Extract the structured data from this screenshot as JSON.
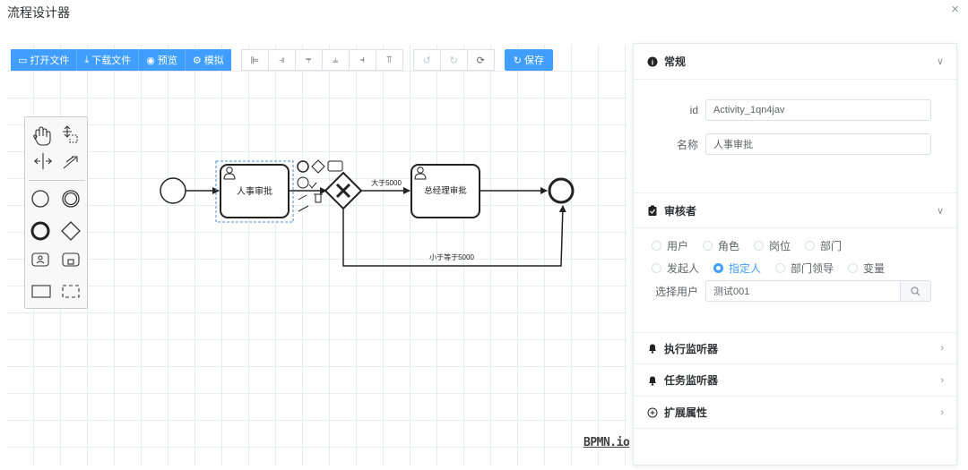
{
  "dialog": {
    "title": "流程设计器",
    "close": "×"
  },
  "toolbar": {
    "open_file": "打开文件",
    "download_file": "下载文件",
    "preview": "预览",
    "simulate": "模拟",
    "save": "保存"
  },
  "diagram": {
    "task1_label": "人事审批",
    "task2_label": "总经理审批",
    "flow_gt_label": "大于5000",
    "flow_le_label": "小于等于5000"
  },
  "watermark": "BPMN.io",
  "panel": {
    "general": {
      "title": "常规",
      "id_label": "id",
      "id_value": "Activity_1qn4jav",
      "name_label": "名称",
      "name_value": "人事审批"
    },
    "reviewer": {
      "title": "审核者",
      "options_row1": [
        "用户",
        "角色",
        "岗位",
        "部门"
      ],
      "options_row2": [
        "发起人",
        "指定人",
        "部门领导",
        "变量"
      ],
      "selected": "指定人",
      "select_user_label": "选择用户",
      "select_user_value": "测试001"
    },
    "exec_listener": {
      "title": "执行监听器"
    },
    "task_listener": {
      "title": "任务监听器"
    },
    "ext_props": {
      "title": "扩展属性"
    }
  },
  "colors": {
    "primary": "#409eff",
    "border": "#dcdfe6",
    "text": "#303133"
  }
}
